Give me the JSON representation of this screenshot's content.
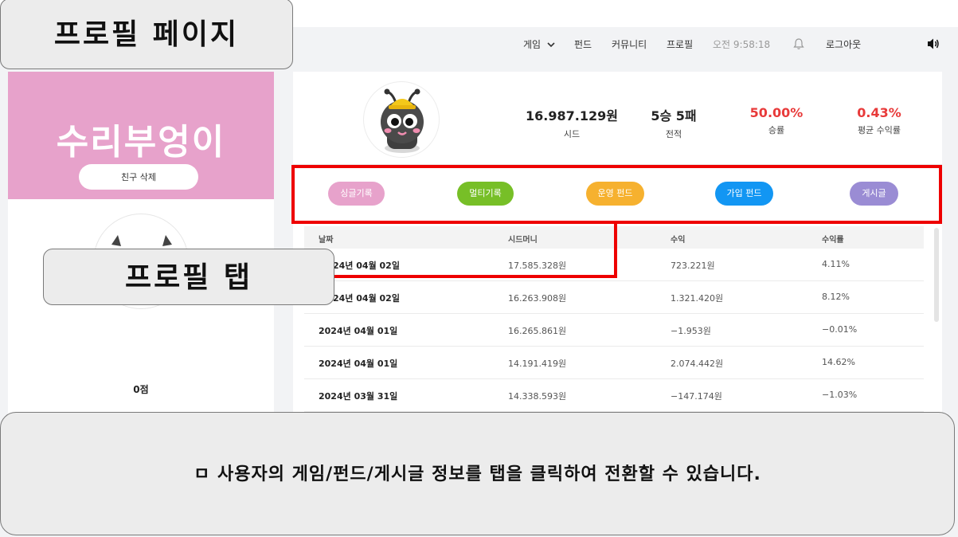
{
  "navbar": {
    "game_label": "게임",
    "fund_label": "펀드",
    "community_label": "커뮤니티",
    "profile_label": "프로필",
    "clock": "오전 9:58:18",
    "logout_label": "로그아웃"
  },
  "profile": {
    "nickname": "수리부엉이",
    "unfriend_label": "친구 삭제",
    "score": "0점"
  },
  "stats": [
    {
      "value": "16.987.129원",
      "label": "시드"
    },
    {
      "value": "5승 5패",
      "label": "전적"
    },
    {
      "value": "50.00%",
      "label": "승률"
    },
    {
      "value": "0.43%",
      "label": "평균 수익률"
    }
  ],
  "tabs": [
    {
      "label": "싱글기록",
      "color": "#e7a2cb"
    },
    {
      "label": "멀티기록",
      "color": "#77bf27"
    },
    {
      "label": "운영 펀드",
      "color": "#f6b12f"
    },
    {
      "label": "가입 펀드",
      "color": "#1296f3"
    },
    {
      "label": "게시글",
      "color": "#9a8cd4"
    }
  ],
  "table": {
    "headers": [
      "날짜",
      "시드머니",
      "수익",
      "수익률"
    ],
    "rows": [
      [
        "24년 04월 02일",
        "17.585.328원",
        "723.221원",
        "4.11%"
      ],
      [
        "24년 04월 02일",
        "16.263.908원",
        "1.321.420원",
        "8.12%"
      ],
      [
        "2024년 04월 01일",
        "16.265.861원",
        "−1.953원",
        "−0.01%"
      ],
      [
        "2024년 04월 01일",
        "14.191.419원",
        "2.074.442원",
        "14.62%"
      ],
      [
        "2024년 03월 31일",
        "14.338.593원",
        "−147.174원",
        "−1.03%"
      ]
    ]
  },
  "overlay": {
    "title": "프로필 페이지",
    "tab_callout": "프로필 탭",
    "caption": "ㅁ 사용자의 게임/펀드/게시글 정보를 탭을 클릭하여 전환할 수 있습니다."
  },
  "colors": {
    "accent_red": "#ee0000",
    "win_rate_red": "#e83a3a",
    "profile_pink": "#e7a2cb"
  }
}
